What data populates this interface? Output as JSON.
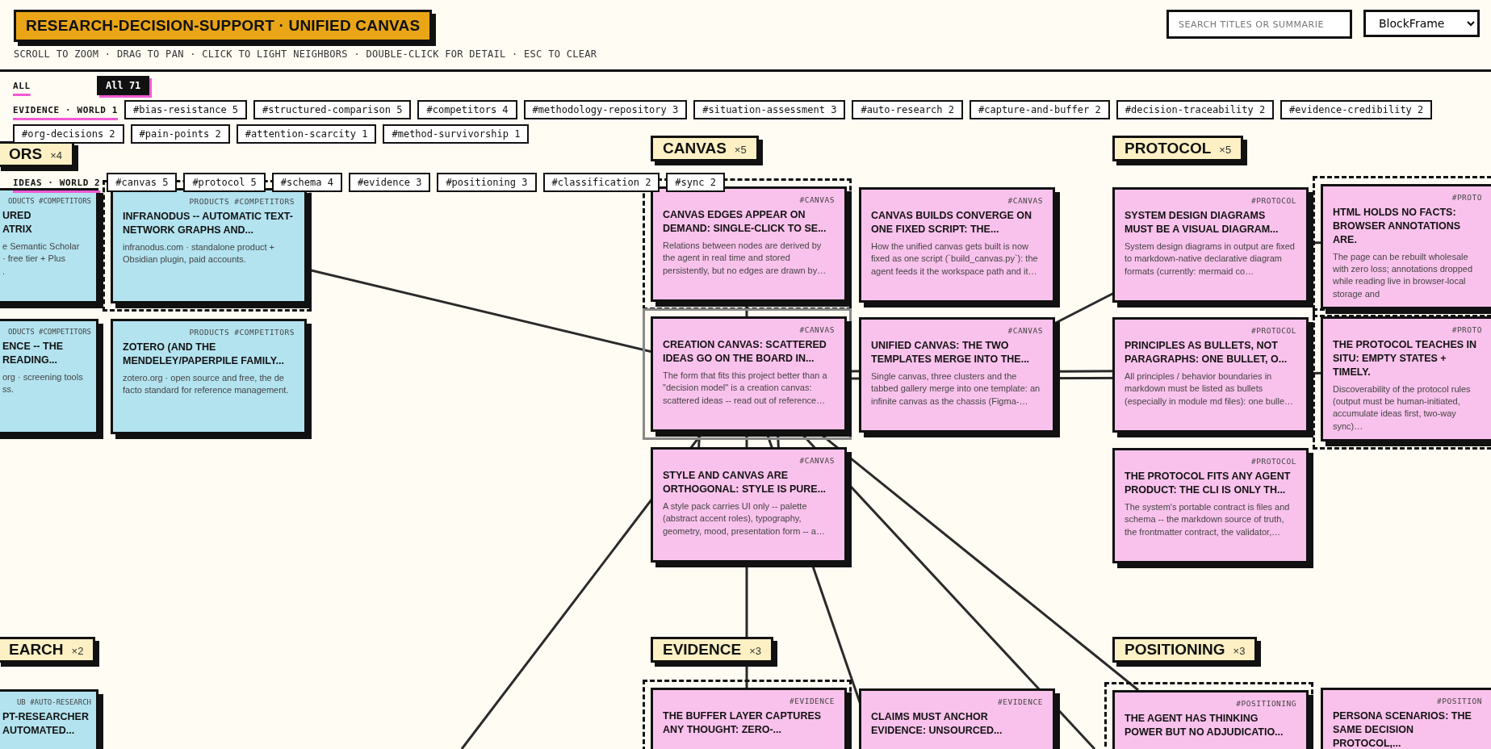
{
  "header": {
    "title": "RESEARCH-DECISION-SUPPORT · UNIFIED CANVAS",
    "hint": "SCROLL TO ZOOM · DRAG TO PAN · CLICK TO LIGHT NEIGHBORS · DOUBLE-CLICK FOR DETAIL · ESC TO CLEAR",
    "search": {
      "placeholder": "SEARCH TITLES OR SUMMARIE"
    },
    "frame_select": {
      "value": "BlockFrame"
    }
  },
  "filters": [
    {
      "label": "ALL",
      "chips": [
        {
          "label": "All 71",
          "selected": true
        }
      ]
    },
    {
      "label": "EVIDENCE · WORLD 1",
      "chips": [
        {
          "label": "#bias-resistance 5",
          "selected": false
        },
        {
          "label": "#structured-comparison 5",
          "selected": false
        },
        {
          "label": "#competitors 4",
          "selected": false
        },
        {
          "label": "#methodology-repository 3",
          "selected": false
        },
        {
          "label": "#situation-assessment 3",
          "selected": false
        },
        {
          "label": "#auto-research 2",
          "selected": false
        },
        {
          "label": "#capture-and-buffer 2",
          "selected": false
        },
        {
          "label": "#decision-traceability 2",
          "selected": false
        },
        {
          "label": "#evidence-credibility 2",
          "selected": false
        },
        {
          "label": "#org-decisions 2",
          "selected": false
        },
        {
          "label": "#pain-points 2",
          "selected": false
        },
        {
          "label": "#attention-scarcity 1",
          "selected": false
        },
        {
          "label": "#method-survivorship 1",
          "selected": false
        }
      ]
    },
    {
      "label": "IDEAS · WORLD 2",
      "chips": [
        {
          "label": "#canvas 5",
          "selected": false
        },
        {
          "label": "#protocol 5",
          "selected": false
        },
        {
          "label": "#schema 4",
          "selected": false
        },
        {
          "label": "#evidence 3",
          "selected": false
        },
        {
          "label": "#positioning 3",
          "selected": false
        },
        {
          "label": "#classification 2",
          "selected": false
        },
        {
          "label": "#sync 2",
          "selected": false
        }
      ]
    }
  ],
  "clusters": [
    {
      "name": "ORS",
      "count": "×4",
      "cards": [
        {
          "tag": "ODUCTS #COMPETITORS",
          "title": "URED\nATRIX",
          "summary": "e Semantic Scholar\n· free tier + Plus\n.",
          "color": "#b3e3ef",
          "lit": false,
          "selected": false
        },
        {
          "tag": "PRODUCTS #COMPETITORS",
          "title": "INFRANODUS -- AUTOMATIC TEXT-NETWORK GRAPHS AND...",
          "summary": "infranodus.com · standalone product + Obsidian plugin, paid accounts.",
          "color": "#b3e3ef",
          "lit": true,
          "selected": false
        },
        {
          "tag": "ODUCTS #COMPETITORS",
          "title": "ENCE -- THE\nREADING...",
          "summary": "org · screening tools\nss.",
          "color": "#b3e3ef",
          "lit": false,
          "selected": false
        },
        {
          "tag": "PRODUCTS #COMPETITORS",
          "title": "ZOTERO (AND THE MENDELEY/PAPERPILE FAMILY...",
          "summary": "zotero.org · open source and free, the de facto standard for reference management.",
          "color": "#b3e3ef",
          "lit": false,
          "selected": false
        }
      ]
    },
    {
      "name": "CANVAS",
      "count": "×5",
      "cards": [
        {
          "tag": "#CANVAS",
          "title": "CANVAS EDGES APPEAR ON DEMAND: SINGLE-CLICK TO SE...",
          "summary": "Relations between nodes are derived by the agent in real time and stored persistently, but no edges are drawn by…",
          "color": "#f9c2ec",
          "lit": true,
          "selected": false
        },
        {
          "tag": "#CANVAS",
          "title": "CANVAS BUILDS CONVERGE ON ONE FIXED SCRIPT: THE...",
          "summary": "How the unified canvas gets built is now fixed as one script (`build_canvas.py`): the agent feeds it the workspace path and it…",
          "color": "#f9c2ec",
          "lit": false,
          "selected": false
        },
        {
          "tag": "#CANVAS",
          "title": "CREATION CANVAS: SCATTERED IDEAS GO ON THE BOARD IN...",
          "summary": "The form that fits this project better than a \"decision model\" is a creation canvas: scattered ideas -- read out of reference…",
          "color": "#f9c2ec",
          "lit": false,
          "selected": true
        },
        {
          "tag": "#CANVAS",
          "title": "UNIFIED CANVAS: THE TWO TEMPLATES MERGE INTO THE...",
          "summary": "Single canvas, three clusters and the tabbed gallery merge into one template: an infinite canvas as the chassis (Figma-…",
          "color": "#f9c2ec",
          "lit": false,
          "selected": false
        },
        {
          "tag": "#CANVAS",
          "title": "STYLE AND CANVAS ARE ORTHOGONAL: STYLE IS PURE...",
          "summary": "A style pack carries UI only -- palette (abstract accent roles), typography, geometry, mood, presentation form -- a…",
          "color": "#f9c2ec",
          "lit": false,
          "selected": false
        }
      ]
    },
    {
      "name": "PROTOCOL",
      "count": "×5",
      "cards": [
        {
          "tag": "#PROTOCOL",
          "title": "SYSTEM DESIGN DIAGRAMS MUST BE A VISUAL DIAGRAM...",
          "summary": "System design diagrams in output are fixed to markdown-native declarative diagram formats (currently: mermaid co…",
          "color": "#f9c2ec",
          "lit": false,
          "selected": false
        },
        {
          "tag": "#PROTO",
          "title": "HTML HOLDS NO FACTS: BROWSER ANNOTATIONS ARE.",
          "summary": "The page can be rebuilt wholesale with zero loss; annotations dropped while reading live in browser-local storage and",
          "color": "#f9c2ec",
          "lit": true,
          "selected": false
        },
        {
          "tag": "#PROTOCOL",
          "title": "PRINCIPLES AS BULLETS, NOT PARAGRAPHS: ONE BULLET, O...",
          "summary": "All principles / behavior boundaries in markdown must be listed as bullets (especially in module md files): one bulle…",
          "color": "#f9c2ec",
          "lit": false,
          "selected": false
        },
        {
          "tag": "#PROTO",
          "title": "THE PROTOCOL TEACHES IN SITU: EMPTY STATES + TIMELY.",
          "summary": "Discoverability of the protocol rules (output must be human-initiated, accumulate ideas first, two-way sync)…",
          "color": "#f9c2ec",
          "lit": true,
          "selected": false
        },
        {
          "tag": "#PROTOCOL",
          "title": "THE PROTOCOL FITS ANY AGENT PRODUCT: THE CLI IS ONLY TH...",
          "summary": "The system's portable contract is files and schema -- the markdown source of truth, the frontmatter contract, the validator,…",
          "color": "#f9c2ec",
          "lit": false,
          "selected": false
        }
      ]
    },
    {
      "name": "EARCH",
      "count": "×2",
      "cards": [
        {
          "tag": "UB #AUTO-RESEARCH",
          "title": "PT-RESEARCHER\nAUTOMATED...",
          "color": "#b3e3ef",
          "lit": false,
          "selected": false
        }
      ]
    },
    {
      "name": "EVIDENCE",
      "count": "×3",
      "cards": [
        {
          "tag": "#EVIDENCE",
          "title": "THE BUFFER LAYER CAPTURES ANY THOUGHT: ZERO-...",
          "color": "#f9c2ec",
          "lit": true,
          "selected": false
        },
        {
          "tag": "#EVIDENCE",
          "title": "CLAIMS MUST ANCHOR EVIDENCE: UNSOURCED...",
          "color": "#f9c2ec",
          "lit": false,
          "selected": false
        }
      ]
    },
    {
      "name": "POSITIONING",
      "count": "×3",
      "cards": [
        {
          "tag": "#POSITIONING",
          "title": "THE AGENT HAS THINKING POWER BUT NO ADJUDICATIO...",
          "color": "#f9c2ec",
          "lit": true,
          "selected": false
        },
        {
          "tag": "#POSITION",
          "title": "PERSONA SCENARIOS: THE SAME DECISION PROTOCOL,...",
          "color": "#f9c2ec",
          "lit": false,
          "selected": false
        }
      ]
    }
  ]
}
